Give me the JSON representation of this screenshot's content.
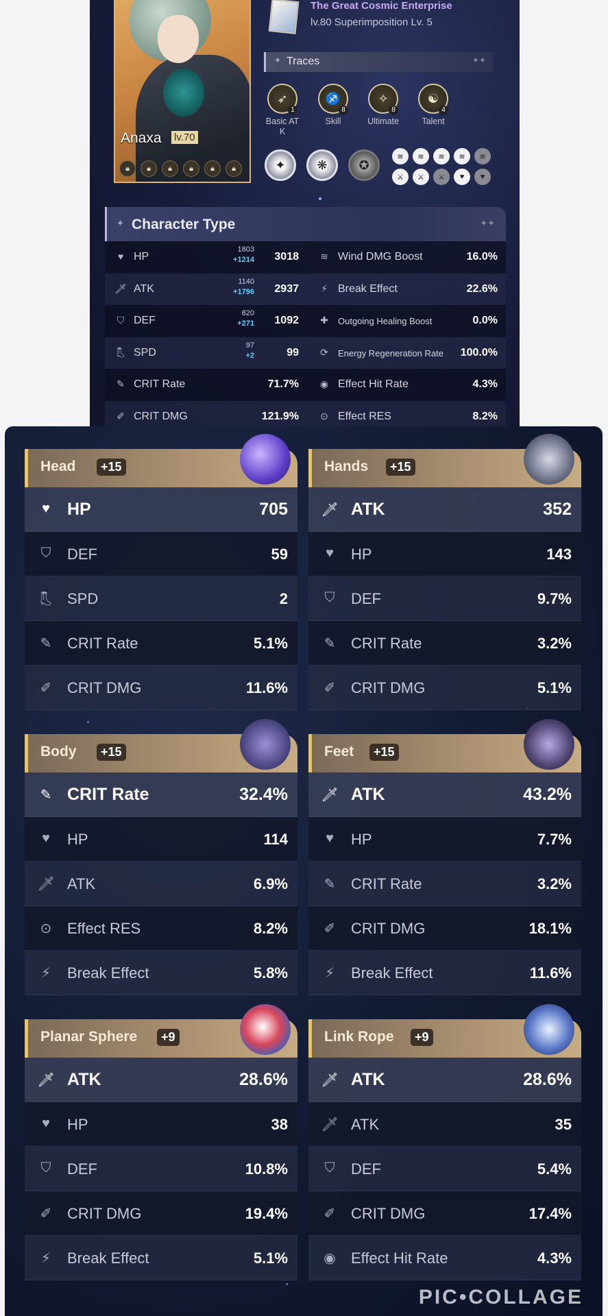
{
  "character": {
    "name": "Anaxa",
    "level": "lv.70",
    "eidolon_locks": 6
  },
  "light_cone": {
    "name": "The Great Cosmic Enterprise",
    "subtitle": "lv.80  Superimposition Lv. 5"
  },
  "traces": {
    "title": "Traces",
    "items": [
      {
        "label": "Basic AT\nK",
        "level": "1"
      },
      {
        "label": "Skill",
        "level": "8"
      },
      {
        "label": "Ultimate",
        "level": "8"
      },
      {
        "label": "Talent",
        "level": "4"
      }
    ]
  },
  "character_type": {
    "title": "Character Type",
    "left": [
      {
        "name": "HP",
        "icon": "heart-icon",
        "base": "1803",
        "add": "+1214",
        "value": "3018"
      },
      {
        "name": "ATK",
        "icon": "sword-icon",
        "base": "1140",
        "add": "+1796",
        "value": "2937"
      },
      {
        "name": "DEF",
        "icon": "shield-icon",
        "base": "820",
        "add": "+271",
        "value": "1092"
      },
      {
        "name": "SPD",
        "icon": "boot-icon",
        "base": "97",
        "add": "+2",
        "value": "99"
      },
      {
        "name": "CRIT Rate",
        "icon": "crit-rate-icon",
        "base": "",
        "add": "",
        "value": "71.7%"
      },
      {
        "name": "CRIT DMG",
        "icon": "crit-dmg-icon",
        "base": "",
        "add": "",
        "value": "121.9%"
      }
    ],
    "right": [
      {
        "name": "Wind DMG Boost",
        "icon": "wind-icon",
        "value": "16.0%",
        "small": false
      },
      {
        "name": "Break Effect",
        "icon": "break-icon",
        "value": "22.6%",
        "small": false
      },
      {
        "name": "Outgoing Healing Boost",
        "icon": "heal-icon",
        "value": "0.0%",
        "small": true
      },
      {
        "name": "Energy Regeneration Rate",
        "icon": "energy-icon",
        "value": "100.0%",
        "small": true
      },
      {
        "name": "Effect Hit Rate",
        "icon": "effect-hit-icon",
        "value": "4.3%",
        "small": false
      },
      {
        "name": "Effect RES",
        "icon": "effect-res-icon",
        "value": "8.2%",
        "small": false
      }
    ]
  },
  "relics": [
    {
      "slot": "Head",
      "level": "+15",
      "main": {
        "name": "HP",
        "value": "705",
        "icon": "heart-icon"
      },
      "subs": [
        {
          "name": "DEF",
          "value": "59",
          "icon": "shield-icon"
        },
        {
          "name": "SPD",
          "value": "2",
          "icon": "boot-icon"
        },
        {
          "name": "CRIT Rate",
          "value": "5.1%",
          "icon": "crit-rate-icon"
        },
        {
          "name": "CRIT DMG",
          "value": "11.6%",
          "icon": "crit-dmg-icon"
        }
      ]
    },
    {
      "slot": "Hands",
      "level": "+15",
      "main": {
        "name": "ATK",
        "value": "352",
        "icon": "sword-icon"
      },
      "subs": [
        {
          "name": "HP",
          "value": "143",
          "icon": "heart-icon"
        },
        {
          "name": "DEF",
          "value": "9.7%",
          "icon": "shield-icon"
        },
        {
          "name": "CRIT Rate",
          "value": "3.2%",
          "icon": "crit-rate-icon"
        },
        {
          "name": "CRIT DMG",
          "value": "5.1%",
          "icon": "crit-dmg-icon"
        }
      ]
    },
    {
      "slot": "Body",
      "level": "+15",
      "main": {
        "name": "CRIT Rate",
        "value": "32.4%",
        "icon": "crit-rate-icon"
      },
      "subs": [
        {
          "name": "HP",
          "value": "114",
          "icon": "heart-icon"
        },
        {
          "name": "ATK",
          "value": "6.9%",
          "icon": "sword-icon"
        },
        {
          "name": "Effect RES",
          "value": "8.2%",
          "icon": "effect-res-icon"
        },
        {
          "name": "Break Effect",
          "value": "5.8%",
          "icon": "break-icon"
        }
      ]
    },
    {
      "slot": "Feet",
      "level": "+15",
      "main": {
        "name": "ATK",
        "value": "43.2%",
        "icon": "sword-icon"
      },
      "subs": [
        {
          "name": "HP",
          "value": "7.7%",
          "icon": "heart-icon"
        },
        {
          "name": "CRIT Rate",
          "value": "3.2%",
          "icon": "crit-rate-icon"
        },
        {
          "name": "CRIT DMG",
          "value": "18.1%",
          "icon": "crit-dmg-icon"
        },
        {
          "name": "Break Effect",
          "value": "11.6%",
          "icon": "break-icon"
        }
      ]
    },
    {
      "slot": "Planar Sphere",
      "level": "+9",
      "main": {
        "name": "ATK",
        "value": "28.6%",
        "icon": "sword-icon"
      },
      "subs": [
        {
          "name": "HP",
          "value": "38",
          "icon": "heart-icon"
        },
        {
          "name": "DEF",
          "value": "10.8%",
          "icon": "shield-icon"
        },
        {
          "name": "CRIT DMG",
          "value": "19.4%",
          "icon": "crit-dmg-icon"
        },
        {
          "name": "Break Effect",
          "value": "5.1%",
          "icon": "break-icon"
        }
      ]
    },
    {
      "slot": "Link Rope",
      "level": "+9",
      "main": {
        "name": "ATK",
        "value": "28.6%",
        "icon": "sword-icon"
      },
      "subs": [
        {
          "name": "ATK",
          "value": "35",
          "icon": "sword-icon"
        },
        {
          "name": "DEF",
          "value": "5.4%",
          "icon": "shield-icon"
        },
        {
          "name": "CRIT DMG",
          "value": "17.4%",
          "icon": "crit-dmg-icon"
        },
        {
          "name": "Effect Hit Rate",
          "value": "4.3%",
          "icon": "effect-hit-icon"
        }
      ]
    }
  ],
  "watermark": "PIC•COLLAGE"
}
